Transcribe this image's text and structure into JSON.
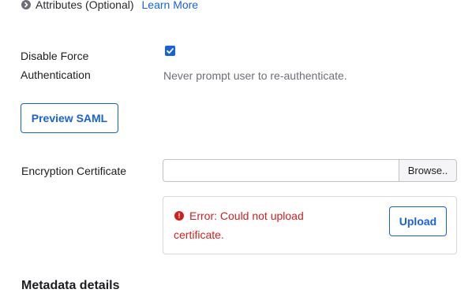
{
  "attributes": {
    "icon": "chevron-right-icon",
    "label": "Attributes (Optional)",
    "learn_more": "Learn More"
  },
  "force_auth": {
    "label_line1": "Disable Force",
    "label_line2": "Authentication",
    "checked": true,
    "hint": "Never prompt user to re-authenticate."
  },
  "preview_saml": {
    "label": "Preview SAML"
  },
  "encryption": {
    "label": "Encryption Certificate",
    "file_value": "",
    "browse_label": "Browse.."
  },
  "upload": {
    "error_line1": "Error: Could not upload",
    "error_line2": "certificate.",
    "button_label": "Upload"
  },
  "metadata": {
    "heading": "Metadata details"
  },
  "colors": {
    "accent": "#1662dd",
    "error": "#d11f1f"
  }
}
